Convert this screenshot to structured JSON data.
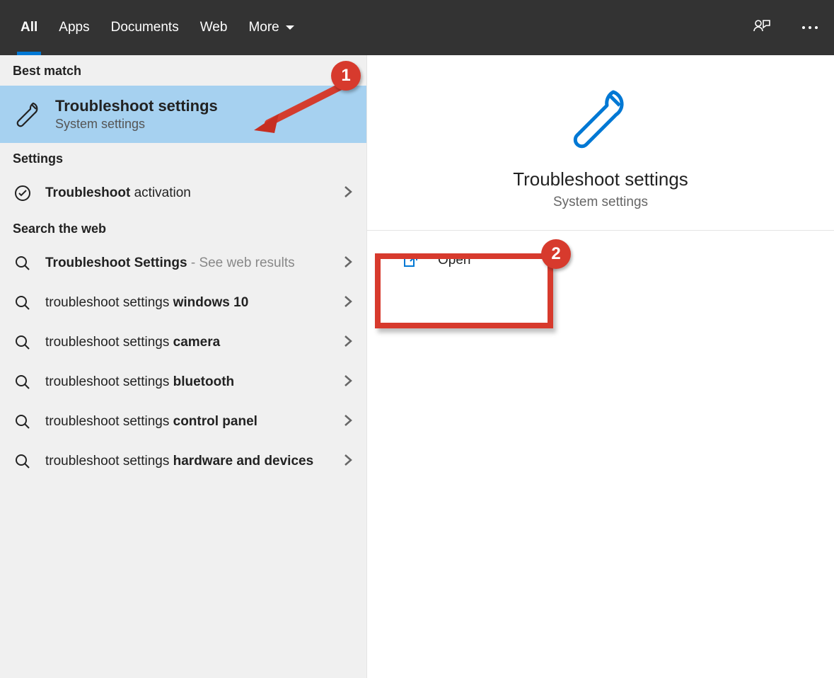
{
  "topbar": {
    "tabs": [
      "All",
      "Apps",
      "Documents",
      "Web",
      "More"
    ]
  },
  "sections": {
    "bestMatch": "Best match",
    "settings": "Settings",
    "searchWeb": "Search the web"
  },
  "bestMatch": {
    "title": "Troubleshoot settings",
    "subtitle": "System settings"
  },
  "settingsResults": [
    {
      "prefixBold": "Troubleshoot",
      "rest": " activation"
    }
  ],
  "webResults": [
    {
      "bold": "Troubleshoot Settings",
      "suffix": " - See web results",
      "suffixGray": true
    },
    {
      "prefix": "troubleshoot settings ",
      "bold": "windows 10"
    },
    {
      "prefix": "troubleshoot settings ",
      "bold": "camera"
    },
    {
      "prefix": "troubleshoot settings ",
      "bold": "bluetooth"
    },
    {
      "prefix": "troubleshoot settings ",
      "bold": "control panel"
    },
    {
      "prefix": "troubleshoot settings ",
      "bold": "hardware and devices"
    }
  ],
  "preview": {
    "title": "Troubleshoot settings",
    "subtitle": "System settings",
    "open": "Open"
  },
  "annotations": {
    "badge1": "1",
    "badge2": "2"
  }
}
